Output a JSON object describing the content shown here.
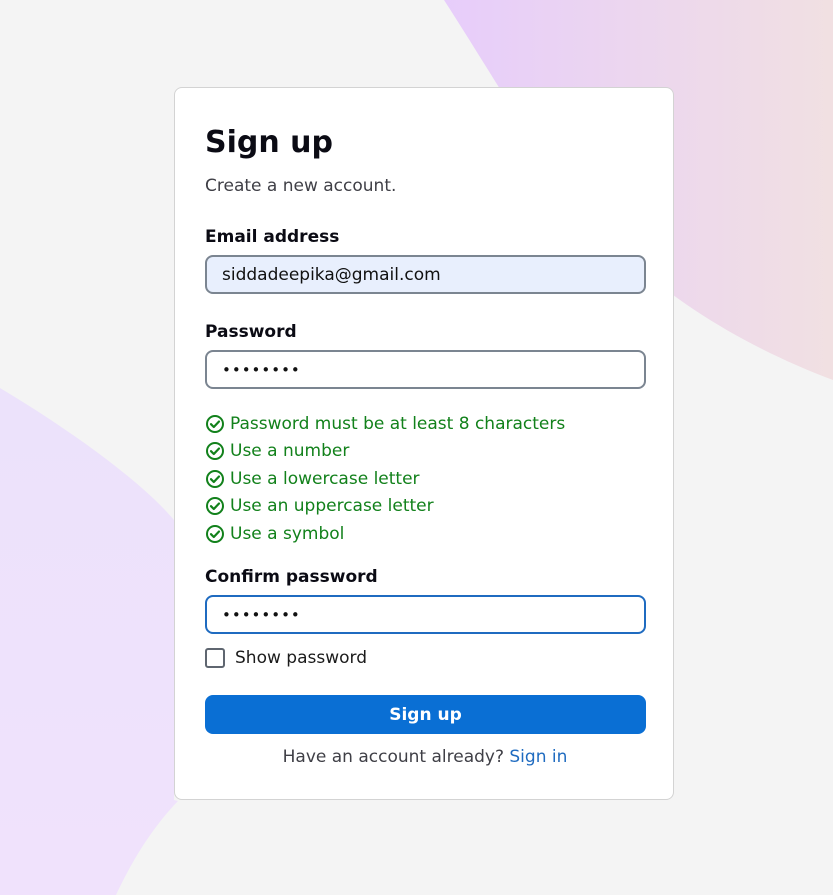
{
  "colors": {
    "background": "#f4f4f4",
    "card": "#ffffff",
    "accent": "#0a6fd4",
    "link": "#1f6bc0",
    "success": "#12811b",
    "autofill": "#e8effd"
  },
  "form": {
    "title": "Sign up",
    "subtitle": "Create a new account.",
    "email": {
      "label": "Email address",
      "value": "siddadeepika@gmail.com"
    },
    "password": {
      "label": "Password",
      "value": "••••••••"
    },
    "rules": [
      {
        "text": "Password must be at least 8 characters",
        "icon": "check-circle-icon",
        "status": "met"
      },
      {
        "text": "Use a number",
        "icon": "check-circle-icon",
        "status": "met"
      },
      {
        "text": "Use a lowercase letter",
        "icon": "check-circle-icon",
        "status": "met"
      },
      {
        "text": "Use an uppercase letter",
        "icon": "check-circle-icon",
        "status": "met"
      },
      {
        "text": "Use a symbol",
        "icon": "check-circle-icon",
        "status": "met"
      }
    ],
    "confirm": {
      "label": "Confirm password",
      "value": "••••••••"
    },
    "show_password": {
      "label": "Show password",
      "checked": false
    },
    "submit_label": "Sign up",
    "footer": {
      "prompt": "Have an account already? ",
      "link_label": "Sign in"
    }
  }
}
